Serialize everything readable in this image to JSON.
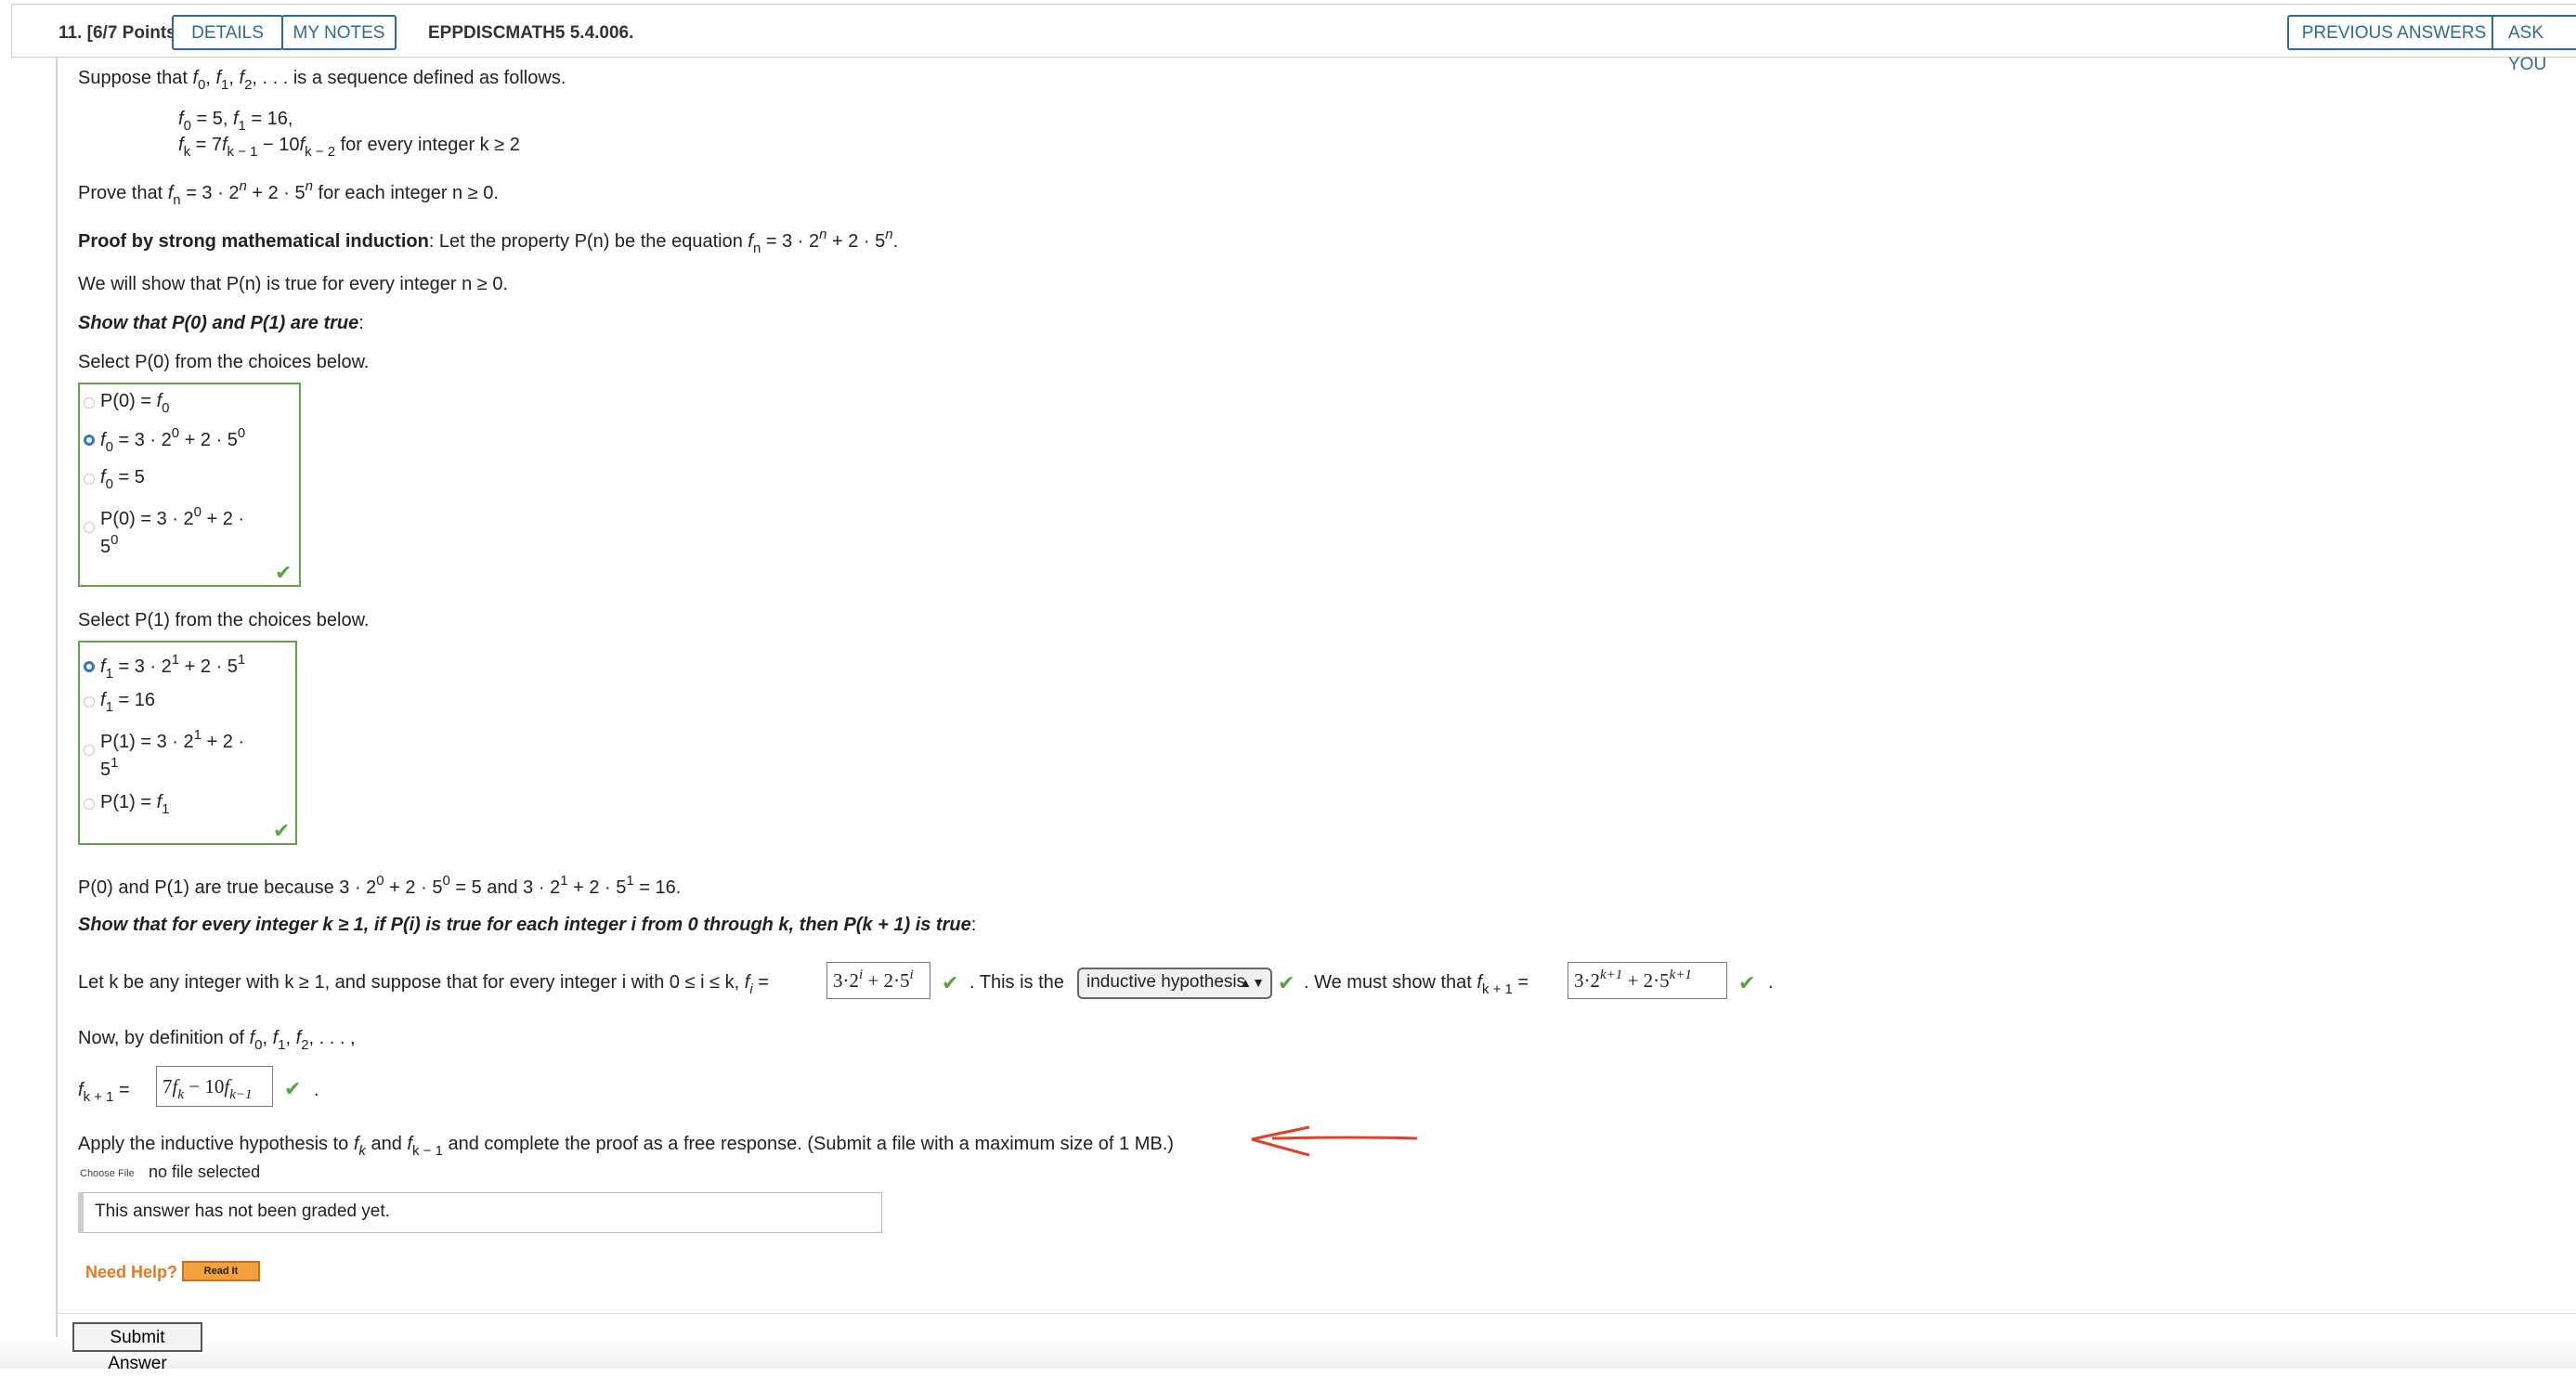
{
  "header": {
    "points": "11. [6/7 Points]",
    "details_label": "DETAILS",
    "notes_label": "MY NOTES",
    "question_id": "EPPDISCMATH5 5.4.006.",
    "previous_answers_label": "PREVIOUS ANSWERS",
    "ask_label": "ASK YOU"
  },
  "problem": {
    "intro_suffix": "is a sequence defined as follows.",
    "def_line1": "= 5, f",
    "def_line1_end": "= 16,",
    "def_line2_suffix": "for every integer k ≥ 2",
    "prove_prefix": "Prove that",
    "prove_suffix": "for each integer n ≥ 0.",
    "proof_bold": "Proof by strong mathematical induction",
    "proof_rest": ": Let the property P(n) be the equation",
    "we_will": "We will show that P(n) is true for every integer n ≥ 0.",
    "show_p0p1": "Show that P(0) and P(1) are true",
    "select_p0": "Select P(0) from the choices below.",
    "select_p1": "Select P(1) from the choices below.",
    "p0p1_true": "P(0) and P(1) are true because",
    "show_step": "Show that for every integer k ≥ 1, if P(i) is true for each integer i from 0 through k, then P(k + 1) is true",
    "let_k": "Let k be any integer with k ≥ 1, and suppose that for every integer i with 0 ≤ i ≤ k,",
    "this_is_the": ". This is the",
    "must_show": ". We must show that",
    "now_def": "Now, by definition of",
    "apply": "Apply the inductive hypothesis to",
    "apply_end": "and complete the proof as a free response. (Submit a file with a maximum size of 1 MB.)",
    "hypothesis_select": "inductive hypothesis"
  },
  "p0_choices": [
    {
      "label": "P(0) = f0",
      "selected": false
    },
    {
      "label": "f0 = 3 · 2^0 + 2 · 5^0",
      "selected": true
    },
    {
      "label": "f0 = 5",
      "selected": false
    },
    {
      "label": "P(0) = 3 · 2^0 + 2 · 5^0",
      "selected": false
    }
  ],
  "p1_choices": [
    {
      "label": "f1 = 3 · 2^1 + 2 · 5^1",
      "selected": true
    },
    {
      "label": "f1 = 16",
      "selected": false
    },
    {
      "label": "P(1) = 3 · 2^1 + 2 · 5^1",
      "selected": false
    },
    {
      "label": "P(1) = f1",
      "selected": false
    }
  ],
  "answers": {
    "fi_answer": "3·2^i + 2·5^i",
    "fk1_answer": "3·2^(k+1) + 2·5^(k+1)",
    "recurrence_answer": "7f_k − 10f_(k−1)"
  },
  "file": {
    "choose_label": "Choose File",
    "status": "no file selected"
  },
  "graded_text": "This answer has not been graded yet.",
  "help": {
    "label": "Need Help?",
    "read_label": "Read It"
  },
  "submit_label": "Submit Answer",
  "colors": {
    "link_blue": "#2d6a9f",
    "correct_green": "#58a63b",
    "radio_blue": "#2e77d0",
    "help_orange": "#e87722",
    "arrow_red": "#e0412a"
  }
}
